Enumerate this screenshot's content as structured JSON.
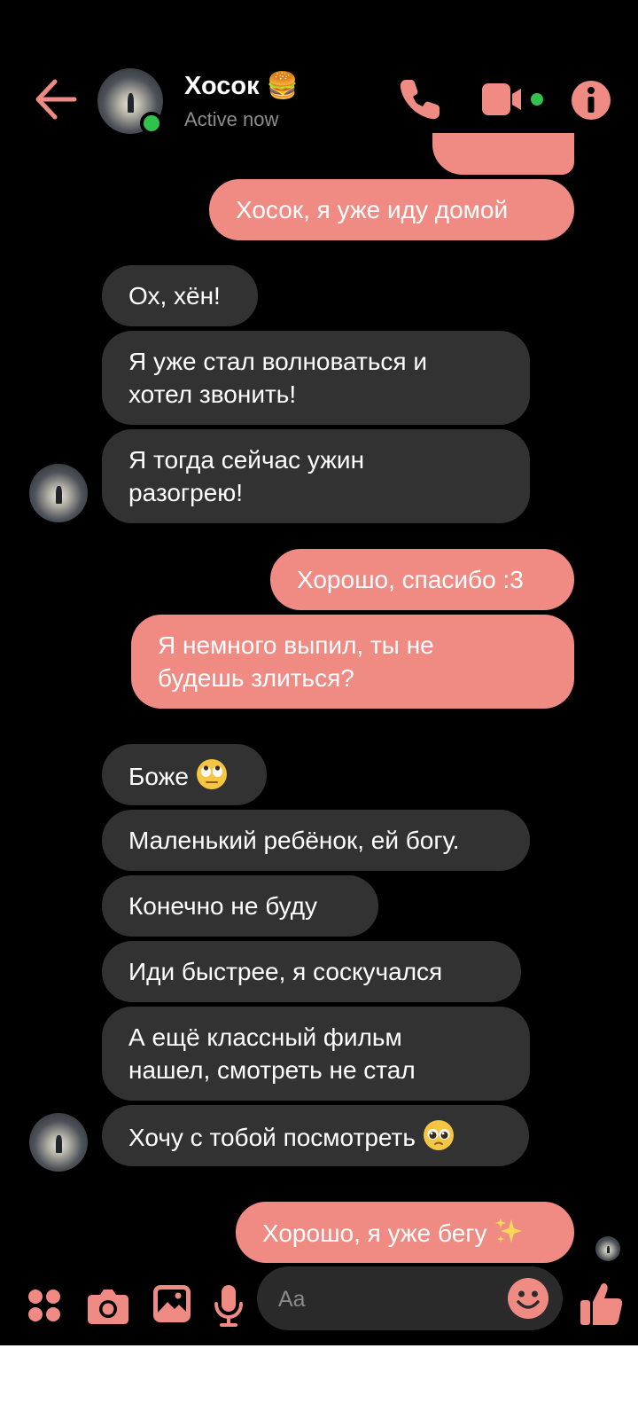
{
  "header": {
    "contact_name": "Хосок 🍔",
    "status": "Active now"
  },
  "messages": [
    {
      "side": "out",
      "text": "Хосок, я уже иду домой"
    },
    {
      "side": "in",
      "text": "Ох, хён!"
    },
    {
      "side": "in",
      "lines": [
        "Я уже стал волноваться и",
        "хотел звонить!"
      ]
    },
    {
      "side": "in",
      "lines": [
        "Я тогда сейчас ужин",
        "разогрею!"
      ]
    },
    {
      "side": "out",
      "text": "Хорошо, спасибо :3"
    },
    {
      "side": "out",
      "lines": [
        "Я немного выпил, ты не",
        "будешь злиться?"
      ]
    },
    {
      "side": "in",
      "text": "Боже",
      "emoji": "eye-roll-emoji"
    },
    {
      "side": "in",
      "text": "Маленький ребёнок, ей богу."
    },
    {
      "side": "in",
      "text": "Конечно не буду"
    },
    {
      "side": "in",
      "text": "Иди быстрее, я соскучался"
    },
    {
      "side": "in",
      "lines": [
        "А ещё классный фильм",
        "нашел, смотреть не стал"
      ]
    },
    {
      "side": "in",
      "text": "Хочу с тобой посмотреть",
      "emoji": "pleading-face-emoji"
    },
    {
      "side": "out",
      "text": "Хорошо, я уже бегу",
      "emoji": "sparkles-emoji"
    }
  ],
  "composer": {
    "placeholder": "Aa"
  },
  "colors": {
    "accent": "#f08b84",
    "incoming_bubble": "#333233",
    "background": "#000000",
    "online": "#31c24d"
  },
  "icons": [
    "back-arrow-icon",
    "phone-icon",
    "video-camera-icon",
    "info-icon",
    "apps-grid-icon",
    "camera-icon",
    "gallery-icon",
    "microphone-icon",
    "emoji-icon",
    "thumbs-up-icon"
  ]
}
